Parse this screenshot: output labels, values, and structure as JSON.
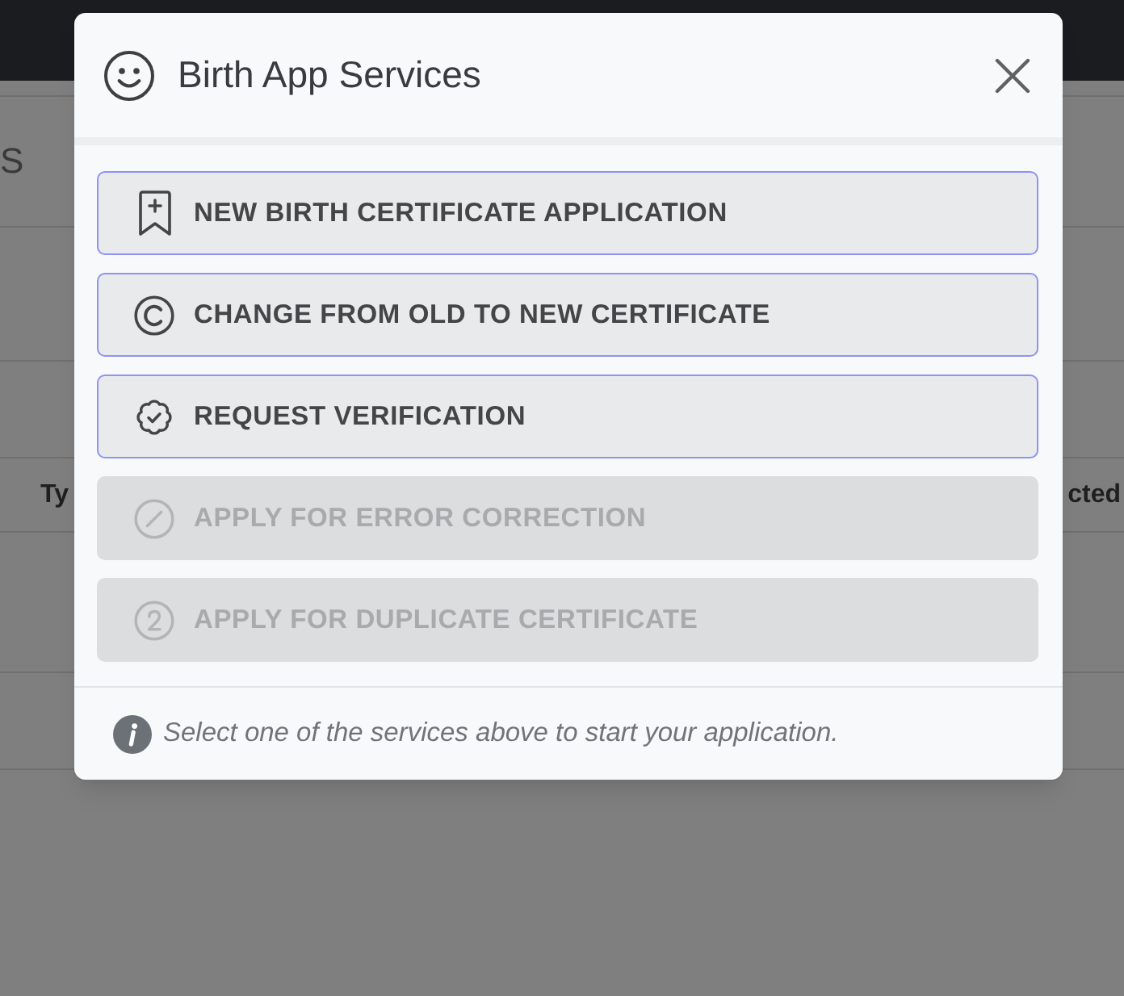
{
  "page": {
    "heading": "S",
    "table": {
      "columns": [
        "Ty",
        "cted"
      ]
    }
  },
  "dialog": {
    "title": "Birth App Services",
    "services": [
      {
        "label": "NEW BIRTH CERTIFICATE APPLICATION",
        "disabled": false
      },
      {
        "label": "CHANGE FROM OLD TO NEW CERTIFICATE",
        "disabled": false
      },
      {
        "label": "REQUEST VERIFICATION",
        "disabled": false
      },
      {
        "label": "APPLY FOR ERROR CORRECTION",
        "disabled": true
      },
      {
        "label": "APPLY FOR DUPLICATE CERTIFICATE",
        "disabled": true
      }
    ],
    "note": "Select one of the services above to start your application."
  }
}
